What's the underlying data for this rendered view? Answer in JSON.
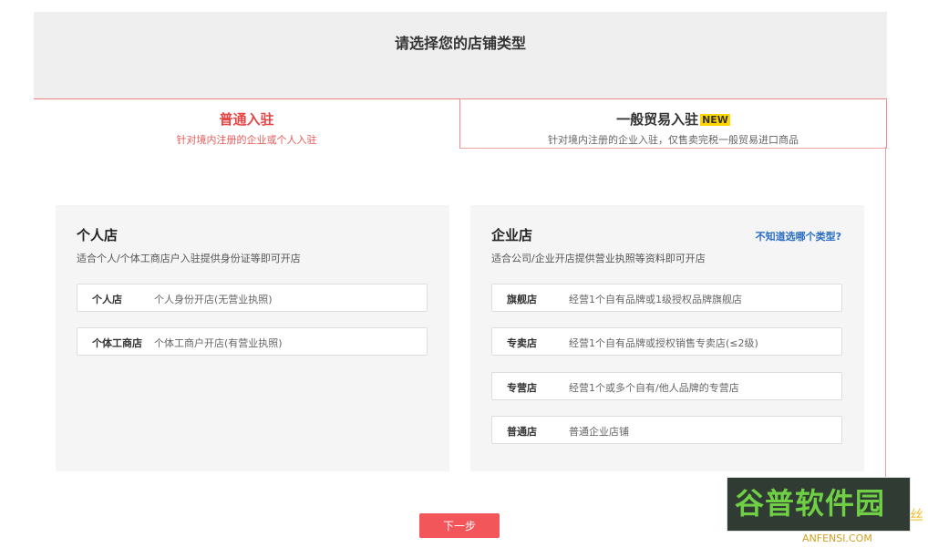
{
  "page": {
    "title": "请选择您的店铺类型"
  },
  "tabs": [
    {
      "label": "普通入驻",
      "sub": "针对境内注册的企业或个人入驻",
      "active": true
    },
    {
      "label": "一般贸易入驻",
      "badge": "NEW",
      "sub": "针对境内注册的企业入驻，仅售卖完税一般贸易进口商品",
      "active": false
    }
  ],
  "personal": {
    "title": "个人店",
    "desc": "适合个人/个体工商店户入驻提供身份证等即可开店",
    "options": [
      {
        "name": "个人店",
        "desc": "个人身份开店(无营业执照)"
      },
      {
        "name": "个体工商店",
        "desc": "个体工商户开店(有营业执照)"
      }
    ]
  },
  "enterprise": {
    "title": "企业店",
    "desc": "适合公司/企业开店提供营业执照等资料即可开店",
    "help": "不知道选哪个类型?",
    "options": [
      {
        "name": "旗舰店",
        "desc": "经营1个自有品牌或1级授权品牌旗舰店"
      },
      {
        "name": "专卖店",
        "desc": "经营1个自有品牌或授权销售专卖店(≤2级)"
      },
      {
        "name": "专营店",
        "desc": "经营1个或多个自有/他人品牌的专营店"
      },
      {
        "name": "普通店",
        "desc": "普通企业店铺"
      }
    ]
  },
  "footer": {
    "next": "下一步"
  },
  "watermark": {
    "text": "谷普软件园",
    "extra": "丝",
    "site": "ANFENSI.COM"
  },
  "colors": {
    "accent": "#f2555a",
    "active_tab_text": "#e64545",
    "badge": "#ffd600",
    "link": "#2a6ec5"
  }
}
